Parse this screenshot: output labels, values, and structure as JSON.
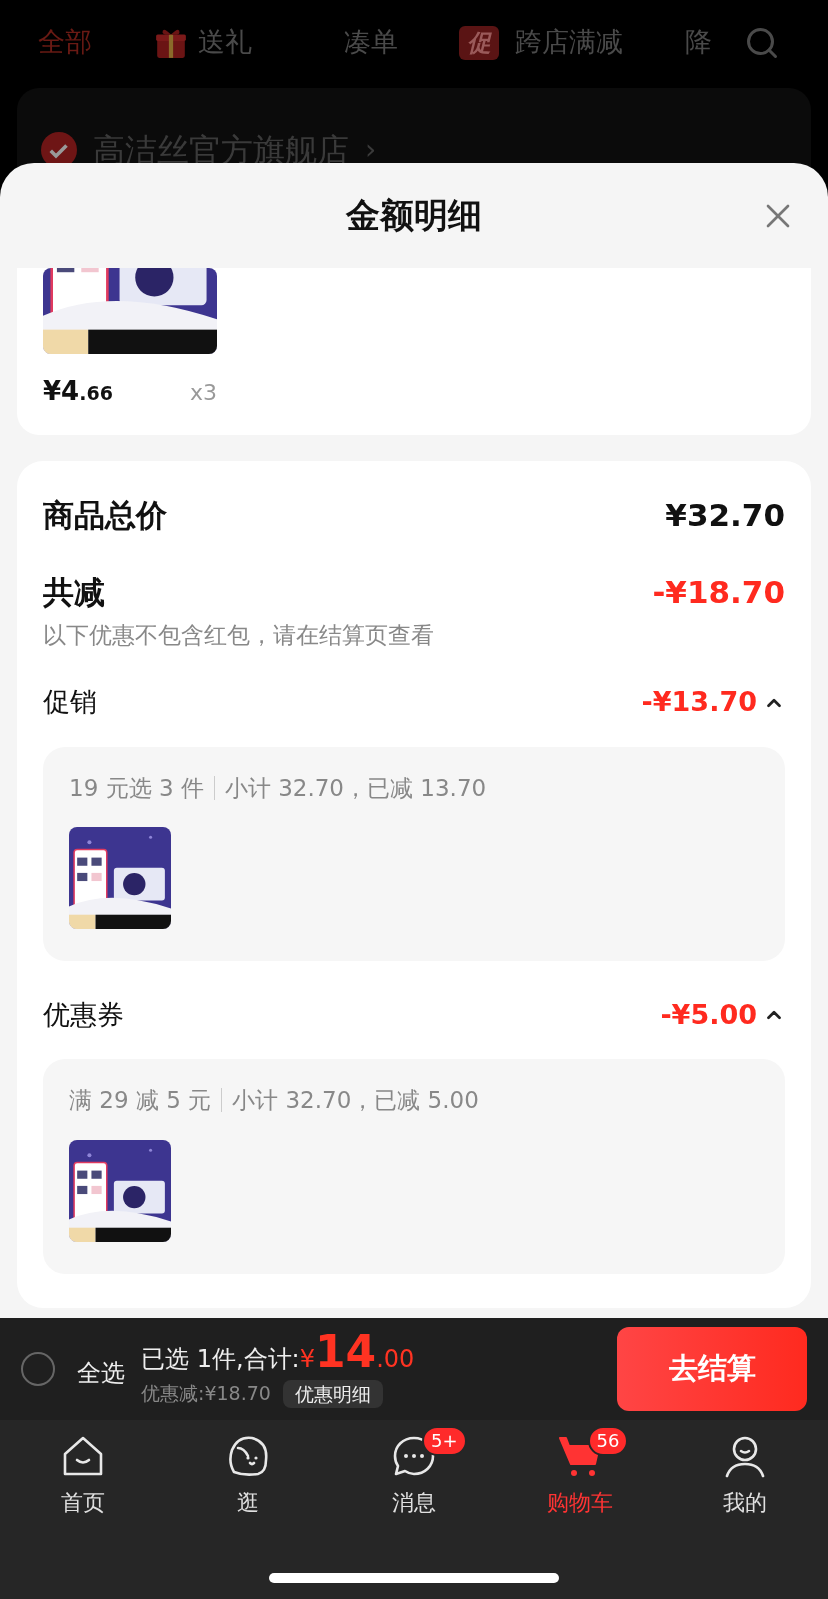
{
  "top_tabs": [
    {
      "kind": "text",
      "label": "全部",
      "selected": true
    },
    {
      "kind": "gift",
      "label": "送礼",
      "selected": false
    },
    {
      "kind": "text",
      "label": "凑单",
      "selected": false
    },
    {
      "kind": "promo",
      "badge": "促",
      "label": "跨店满减",
      "selected": false
    },
    {
      "kind": "text",
      "label": "降",
      "selected": false
    }
  ],
  "store": {
    "name": "高洁丝官方旗舰店",
    "chevron": "›",
    "checked": true
  },
  "sheet": {
    "title": "金额明细",
    "item": {
      "price_main": "¥4",
      "price_decimal": ".66",
      "quantity": "x3"
    },
    "total": {
      "label": "商品总价",
      "value": "¥32.70"
    },
    "reduction": {
      "label": "共减",
      "value": "-¥18.70",
      "note": "以下优惠不包含红包，请在结算页查看"
    },
    "sections": [
      {
        "label": "促销",
        "value": "-¥13.70",
        "expanded": true,
        "rule": "19 元选 3 件",
        "summary": "小计 32.70，已减 13.70"
      },
      {
        "label": "优惠券",
        "value": "-¥5.00",
        "expanded": true,
        "rule": "满 29 减 5 元",
        "summary": "小计 32.70，已减 5.00"
      }
    ]
  },
  "checkout_bar": {
    "select_all": {
      "label": "全选",
      "checked": false
    },
    "selected_label": "已选 1件,合计:",
    "total_symbol": "¥",
    "total_int": "14",
    "total_decimal": ".00",
    "discount": "优惠减:¥18.70",
    "detail_button": "优惠明细",
    "checkout_button": "去结算"
  },
  "nav": [
    {
      "kind": "home",
      "label": "首页",
      "selected": false
    },
    {
      "kind": "browse",
      "label": "逛",
      "selected": false
    },
    {
      "kind": "messages",
      "label": "消息",
      "badge": "5+",
      "selected": false
    },
    {
      "kind": "cart",
      "label": "购物车",
      "badge": "56",
      "selected": true
    },
    {
      "kind": "profile",
      "label": "我的",
      "selected": false
    }
  ]
}
